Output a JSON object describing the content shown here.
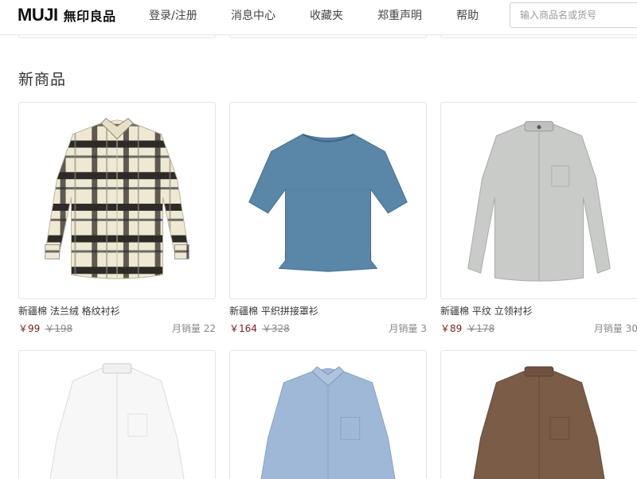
{
  "header": {
    "logo_en": "MUJI",
    "logo_cn": "無印良品",
    "nav": [
      "登录/注册",
      "消息中心",
      "收藏夹",
      "郑重声明",
      "帮助"
    ],
    "search_placeholder": "输入商品名或货号"
  },
  "section": {
    "title": "新商品"
  },
  "products": [
    {
      "name": "新疆棉 法兰绒 格纹衬衫",
      "price": "￥99",
      "old_price": "￥198",
      "sales": "月销量 22",
      "image": "plaid-shirt"
    },
    {
      "name": "新疆棉 平织拼接罩衫",
      "price": "￥164",
      "old_price": "￥328",
      "sales": "月销量 3",
      "image": "blue-blouse"
    },
    {
      "name": "新疆棉 平纹 立领衬衫",
      "price": "￥89",
      "old_price": "￥178",
      "sales": "月销量 30",
      "image": "grey-stand-collar-shirt"
    },
    {
      "image": "white-stand-collar-shirt"
    },
    {
      "image": "light-blue-oxford-shirt"
    },
    {
      "image": "brown-stand-collar-shirt"
    }
  ],
  "colors": {
    "price": "#7a2020",
    "border": "#e6e6e6",
    "plaid_base": "#efe8d2",
    "plaid_dark": "#2d2b26",
    "blue_blouse": "#5a86a8",
    "grey_shirt": "#c9cbc8",
    "light_blue_shirt": "#9fb8d8",
    "brown_shirt": "#7a5c47"
  }
}
